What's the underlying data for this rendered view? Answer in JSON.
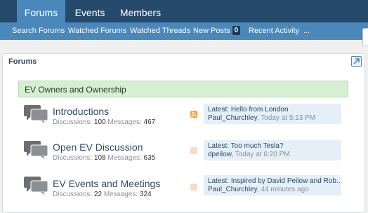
{
  "tabs": [
    {
      "label": "Forums",
      "active": true
    },
    {
      "label": "Events",
      "active": false
    },
    {
      "label": "Members",
      "active": false
    }
  ],
  "subnav": {
    "search_forums": "Search Forums",
    "watched_forums": "Watched Forums",
    "watched_threads": "Watched Threads",
    "new_posts": "New Posts",
    "new_posts_count": "0",
    "recent_activity": "Recent Activity",
    "more": "..."
  },
  "main": {
    "section_title": "Forums",
    "popout_icon": "popout-arrow-icon",
    "category": "EV Owners and Ownership",
    "labels": {
      "discussions": "Discussions:",
      "messages": "Messages:",
      "latest": "Latest:",
      "comma": ","
    },
    "forums": [
      {
        "name": "Introductions",
        "discussions": "100",
        "messages": "467",
        "latest_title": "Hello from London",
        "latest_user": "Paul_Churchley",
        "latest_time": "Today at 5:13 PM",
        "has_new": true
      },
      {
        "name": "Open EV Discussion",
        "discussions": "108",
        "messages": "635",
        "latest_title": "Too much Tesla?",
        "latest_user": "dpeilow",
        "latest_time": "Today at 6:20 PM",
        "has_new": false
      },
      {
        "name": "EV Events and Meetings",
        "discussions": "22",
        "messages": "324",
        "latest_title": "Inspired by David Peilow and Rob…",
        "latest_user": "Paul_Churchley",
        "latest_time": "44 minutes ago",
        "has_new": false
      }
    ]
  },
  "colors": {
    "tabbar": "#254a6c",
    "accent": "#4a88bb",
    "category_bg": "#d4f0d0",
    "latest_bg": "#e4eff8",
    "rss_active": "#f0a23c",
    "rss_inactive": "#f6dcc8"
  }
}
